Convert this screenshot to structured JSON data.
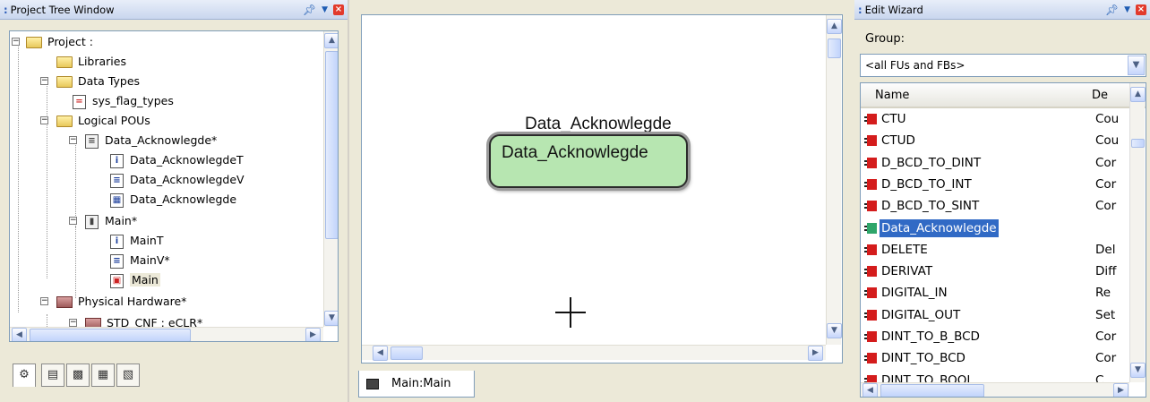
{
  "project_tree": {
    "title": "Project Tree Window",
    "nodes": [
      {
        "label": "Project :"
      },
      {
        "label": "Libraries"
      },
      {
        "label": "Data Types"
      },
      {
        "label": "sys_flag_types"
      },
      {
        "label": "Logical POUs"
      },
      {
        "label": "Data_Acknowlegde*"
      },
      {
        "label": "Data_AcknowlegdeT"
      },
      {
        "label": "Data_AcknowlegdeV"
      },
      {
        "label": "Data_Acknowlegde"
      },
      {
        "label": "Main*"
      },
      {
        "label": "MainT"
      },
      {
        "label": "MainV*"
      },
      {
        "label": "Main"
      },
      {
        "label": "Physical Hardware*"
      },
      {
        "label": "STD_CNF : eCLR*"
      }
    ]
  },
  "editor": {
    "fb_instance": "Data_Acknowlegde",
    "fb_type": "Data_Acknowlegde",
    "tab_label": "Main:Main"
  },
  "edit_wizard": {
    "title": "Edit Wizard",
    "group_label": "Group:",
    "group_value": "<all FUs and FBs>",
    "col_name": "Name",
    "col_desc": "De",
    "rows": [
      {
        "name": "CTU",
        "desc": "Cou",
        "color": "#d41c1c"
      },
      {
        "name": "CTUD",
        "desc": "Cou",
        "color": "#d41c1c"
      },
      {
        "name": "D_BCD_TO_DINT",
        "desc": "Cor",
        "color": "#d41c1c"
      },
      {
        "name": "D_BCD_TO_INT",
        "desc": "Cor",
        "color": "#d41c1c"
      },
      {
        "name": "D_BCD_TO_SINT",
        "desc": "Cor",
        "color": "#d41c1c"
      },
      {
        "name": "Data_Acknowlegde",
        "desc": "",
        "color": "#2ea56a"
      },
      {
        "name": "DELETE",
        "desc": "Del",
        "color": "#d41c1c"
      },
      {
        "name": "DERIVAT",
        "desc": "Diff",
        "color": "#d41c1c"
      },
      {
        "name": "DIGITAL_IN",
        "desc": "Re",
        "color": "#d41c1c"
      },
      {
        "name": "DIGITAL_OUT",
        "desc": "Set",
        "color": "#d41c1c"
      },
      {
        "name": "DINT_TO_B_BCD",
        "desc": "Cor",
        "color": "#d41c1c"
      },
      {
        "name": "DINT_TO_BCD",
        "desc": "Cor",
        "color": "#d41c1c"
      },
      {
        "name": "DINT_TO_BOOL",
        "desc": "C",
        "color": "#d41c1c"
      }
    ]
  }
}
